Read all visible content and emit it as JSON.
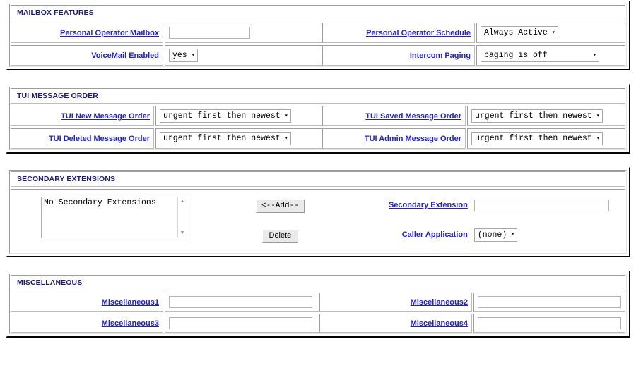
{
  "sections": [
    {
      "id": "mailbox-features",
      "title": "MAILBOX FEATURES",
      "rows": [
        {
          "left": {
            "label": "Personal Operator Mailbox",
            "control": "text",
            "value": ""
          },
          "right": {
            "label": "Personal Operator Schedule",
            "control": "select",
            "value": "Always Active"
          }
        },
        {
          "left": {
            "label": "VoiceMail Enabled",
            "control": "select",
            "value": "yes"
          },
          "right": {
            "label": "Intercom Paging",
            "control": "select",
            "value": "paging is off"
          }
        }
      ]
    },
    {
      "id": "tui-message-order",
      "title": "TUI MESSAGE ORDER",
      "rows": [
        {
          "left": {
            "label": "TUI New Message Order",
            "control": "select",
            "value": "urgent first then newest"
          },
          "right": {
            "label": "TUI Saved Message Order",
            "control": "select",
            "value": "urgent first then newest"
          }
        },
        {
          "left": {
            "label": "TUI Deleted Message Order",
            "control": "select",
            "value": "urgent first then newest"
          },
          "right": {
            "label": "TUI Admin Message Order",
            "control": "select",
            "value": "urgent first then newest"
          }
        }
      ]
    },
    {
      "id": "miscellaneous",
      "title": "MISCELLANEOUS",
      "rows": [
        {
          "left": {
            "label": "Miscellaneous1",
            "control": "text",
            "value": ""
          },
          "right": {
            "label": "Miscellaneous2",
            "control": "text",
            "value": ""
          }
        },
        {
          "left": {
            "label": "Miscellaneous3",
            "control": "text",
            "value": ""
          },
          "right": {
            "label": "Miscellaneous4",
            "control": "text",
            "value": ""
          }
        }
      ]
    }
  ],
  "secondary_extensions": {
    "title": "SECONDARY EXTENSIONS",
    "listbox": {
      "options": [
        "No Secondary Extensions"
      ],
      "selected": "No Secondary Extensions",
      "scroll_up_icon": "▲",
      "scroll_down_icon": "▼"
    },
    "add_button": "<--Add--",
    "delete_button": "Delete",
    "extension_label": "Secondary Extension",
    "extension_value": "",
    "caller_app_label": "Caller Application",
    "caller_app_value": "(none)"
  },
  "icons": {
    "dropdown_arrow": "▾"
  },
  "colors": {
    "link": "#2222cc",
    "section_title": "#1b1b8f",
    "frame": "#d4d0c8",
    "background": "#ffffff"
  }
}
